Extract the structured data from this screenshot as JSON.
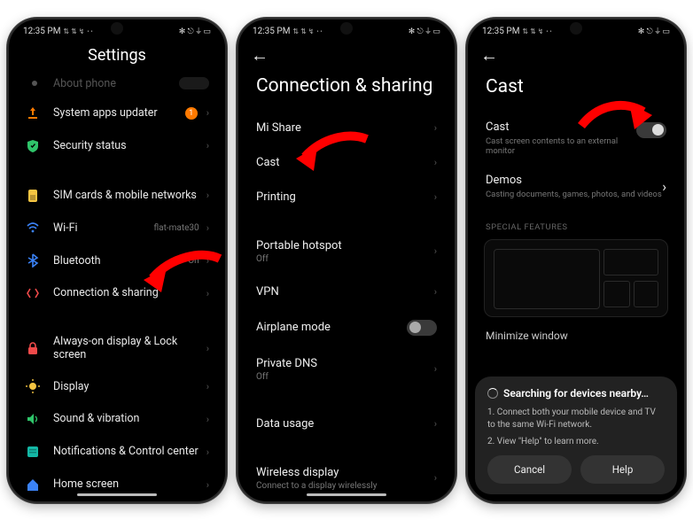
{
  "status": {
    "time": "12:35 PM",
    "signal_icons": "⇅ ⇅ ↯ ･･",
    "right_icons": "✻ ⎋ ⏚ ▭"
  },
  "phone1": {
    "title": "Settings",
    "about_label": "About phone",
    "items": [
      {
        "label": "System apps updater",
        "badge": "1",
        "icon": "updater"
      },
      {
        "label": "Security status",
        "icon": "shield"
      }
    ],
    "group2": [
      {
        "label": "SIM cards & mobile networks",
        "icon": "sim"
      },
      {
        "label": "Wi-Fi",
        "trail": "flat-mate30",
        "icon": "wifi"
      },
      {
        "label": "Bluetooth",
        "trail": "On",
        "icon": "bt"
      },
      {
        "label": "Connection & sharing",
        "icon": "share"
      }
    ],
    "group3": [
      {
        "label": "Always-on display & Lock screen",
        "icon": "lock"
      },
      {
        "label": "Display",
        "icon": "display"
      },
      {
        "label": "Sound & vibration",
        "icon": "sound"
      },
      {
        "label": "Notifications & Control center",
        "icon": "notif"
      },
      {
        "label": "Home screen",
        "icon": "home"
      }
    ]
  },
  "phone2": {
    "title": "Connection & sharing",
    "rows": [
      {
        "label": "Mi Share"
      },
      {
        "label": "Cast"
      },
      {
        "label": "Printing"
      }
    ],
    "group2": [
      {
        "label": "Portable hotspot",
        "sub": "Off"
      },
      {
        "label": "VPN"
      },
      {
        "label": "Airplane mode",
        "toggle": true
      },
      {
        "label": "Private DNS",
        "sub": "Off"
      }
    ],
    "group3": [
      {
        "label": "Data usage"
      }
    ],
    "group4": [
      {
        "label": "Wireless display",
        "sub": "Connect to a display wirelessly"
      }
    ]
  },
  "phone3": {
    "title": "Cast",
    "cast_label": "Cast",
    "cast_sub": "Cast screen contents to an external monitor",
    "demos_label": "Demos",
    "demos_sub": "Casting documents, games, photos, and videos",
    "section_label": "SPECIAL FEATURES",
    "minimize_label": "Minimize window",
    "sheet": {
      "title": "Searching for devices nearby…",
      "line1": "1. Connect both your mobile device and TV to the same Wi-Fi network.",
      "line2": "2. View \"Help\" to learn more.",
      "cancel": "Cancel",
      "help": "Help"
    }
  },
  "colors": {
    "orange": "#ff7a00",
    "green": "#2fc46a",
    "yellow": "#f5c542",
    "blue": "#3b82f6",
    "teal": "#14b8a6",
    "red": "#f04a4a",
    "purple": "#a855f7"
  }
}
